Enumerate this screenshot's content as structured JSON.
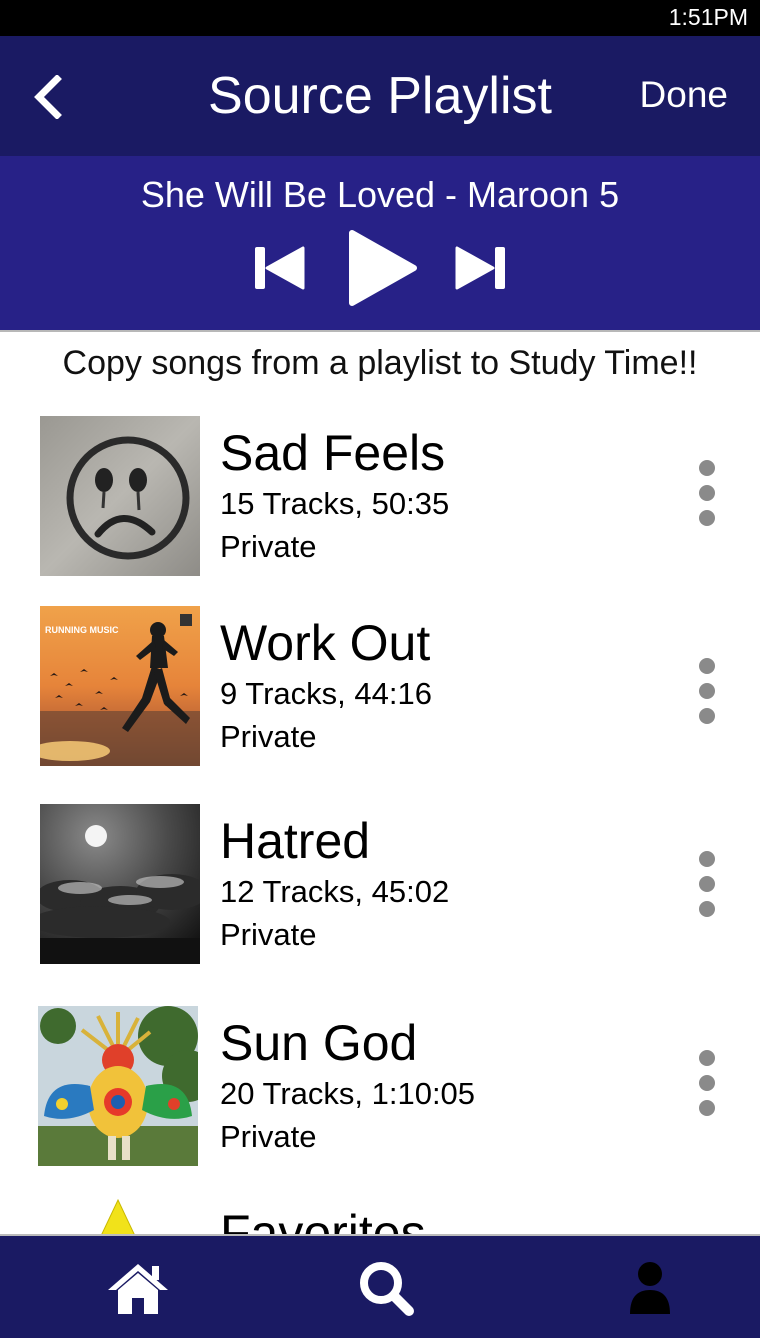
{
  "status_bar": {
    "time": "1:51PM"
  },
  "header": {
    "back_icon": "chevron-left-icon",
    "title": "Source Playlist",
    "done_label": "Done"
  },
  "player": {
    "now_playing": "She Will Be Loved - Maroon 5",
    "controls": [
      "skip-previous-icon",
      "play-icon",
      "skip-next-icon"
    ]
  },
  "instruction": "Copy songs from a playlist to Study Time!!",
  "playlists": [
    {
      "name": "Sad Feels",
      "meta": "15 Tracks, 50:35",
      "privacy": "Private",
      "art": "sad-face-graffiti"
    },
    {
      "name": "Work Out",
      "meta": "9 Tracks, 44:16",
      "privacy": "Private",
      "art": "running-woman-sunset",
      "art_text": "RUNNING MUSIC"
    },
    {
      "name": "Hatred",
      "meta": "12 Tracks, 45:02",
      "privacy": "Private",
      "art": "moon-dark-clouds"
    },
    {
      "name": "Sun God",
      "meta": "20 Tracks, 1:10:05",
      "privacy": "Private",
      "art": "colorful-sculpture"
    },
    {
      "name": "Favorites",
      "meta": "",
      "privacy": "",
      "art": "yellow-star"
    }
  ],
  "bottom_nav": {
    "items": [
      "home-icon",
      "search-icon",
      "profile-icon"
    ]
  },
  "colors": {
    "header_bg": "#1a1a63",
    "player_bg": "#272187",
    "nav_bg": "#1a1a63",
    "more_dots": "#8a8a8a"
  }
}
